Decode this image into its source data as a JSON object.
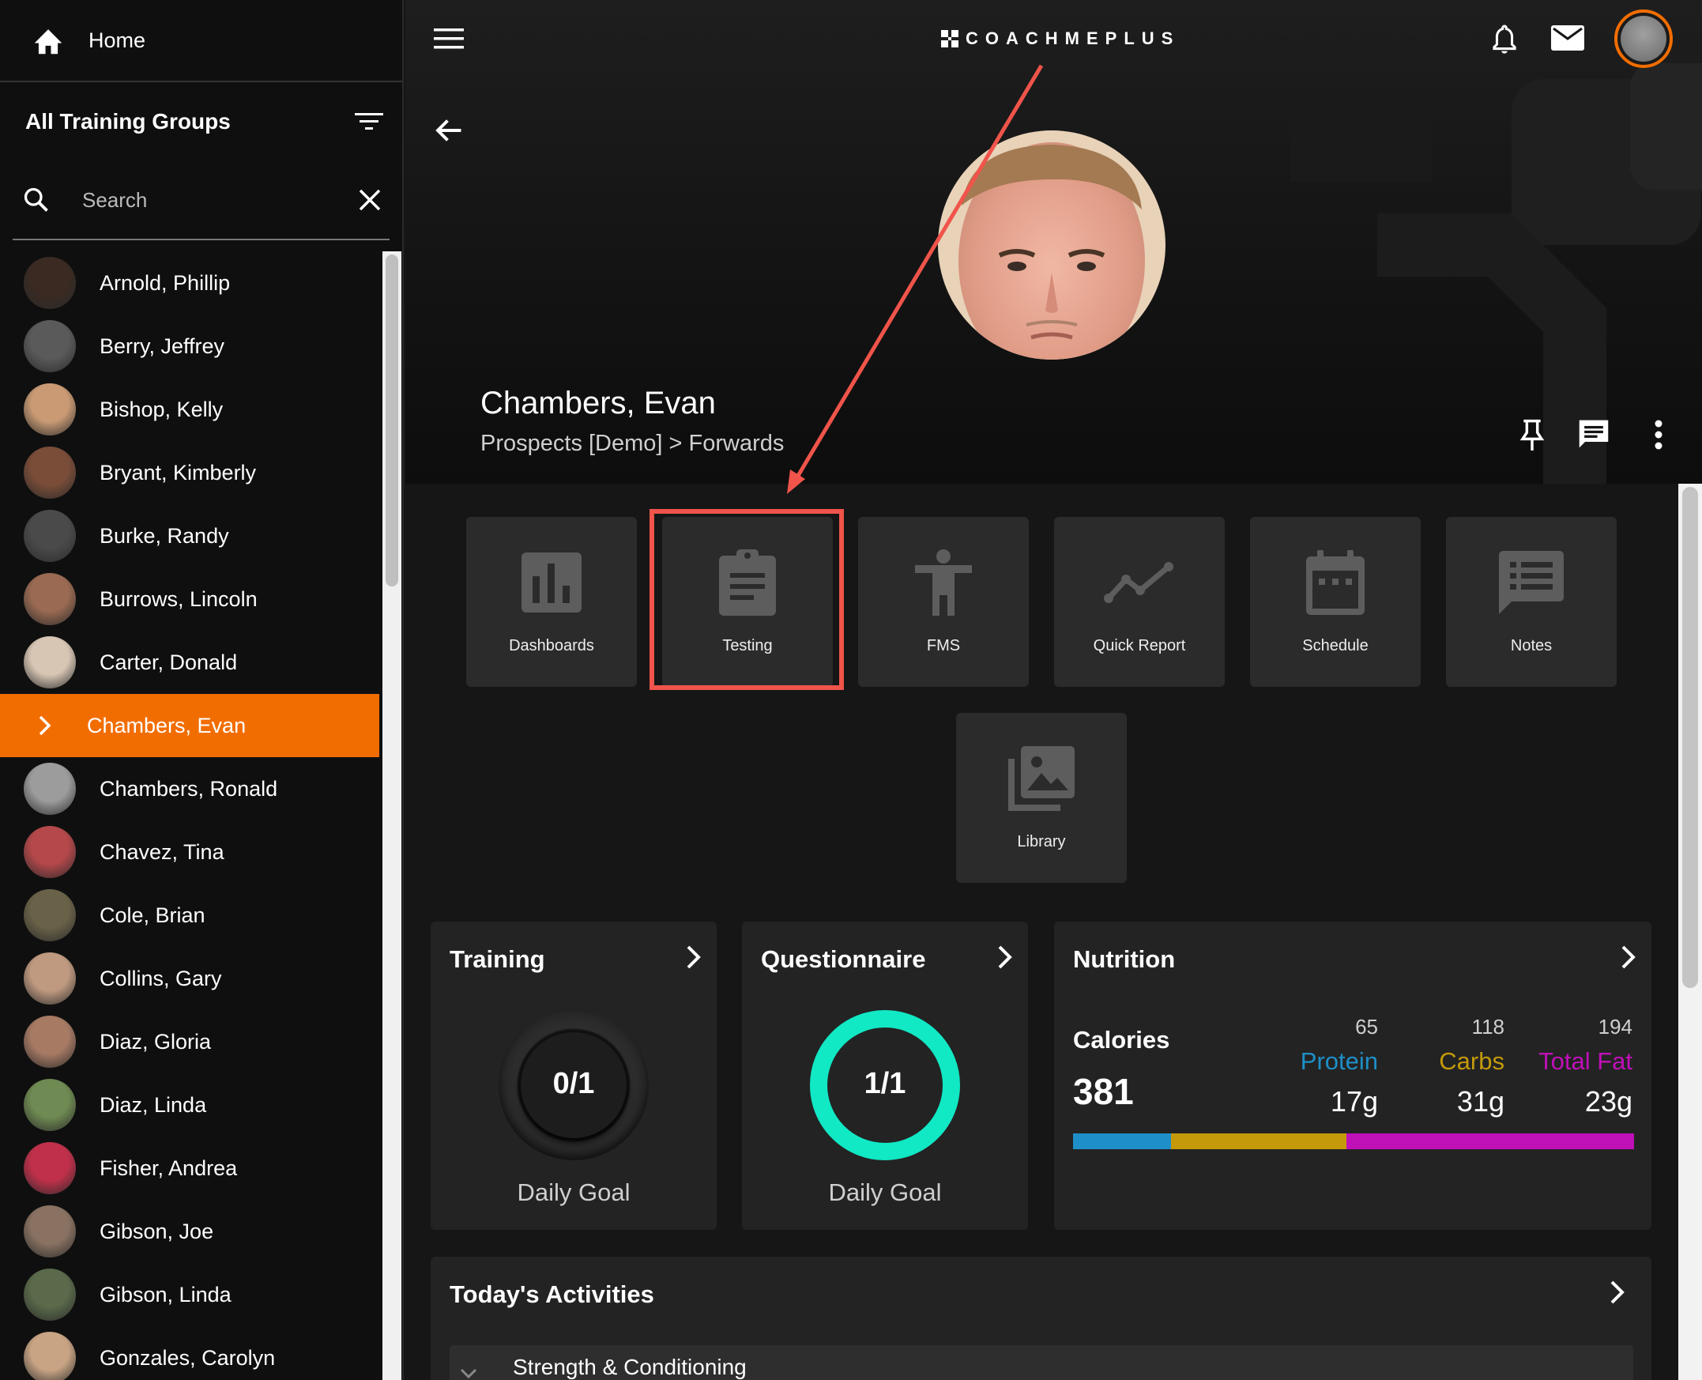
{
  "sidebar": {
    "home_label": "Home",
    "groups_title": "All Training Groups",
    "search_placeholder": "Search",
    "athletes": [
      {
        "name": "Arnold, Phillip",
        "avatar_color": "#3a2a22"
      },
      {
        "name": "Berry, Jeffrey",
        "avatar_color": "#5a5a5a"
      },
      {
        "name": "Bishop, Kelly",
        "avatar_color": "#c99a74"
      },
      {
        "name": "Bryant, Kimberly",
        "avatar_color": "#7a4d38"
      },
      {
        "name": "Burke, Randy",
        "avatar_color": "#4a4a4a"
      },
      {
        "name": "Burrows, Lincoln",
        "avatar_color": "#9a6a52"
      },
      {
        "name": "Carter, Donald",
        "avatar_color": "#d8c6b4"
      },
      {
        "name": "Chambers, Evan",
        "avatar_color": "#d99a82",
        "active": true
      },
      {
        "name": "Chambers, Ronald",
        "avatar_color": "#9c9c9c"
      },
      {
        "name": "Chavez, Tina",
        "avatar_color": "#b4484a"
      },
      {
        "name": "Cole, Brian",
        "avatar_color": "#6a6248"
      },
      {
        "name": "Collins, Gary",
        "avatar_color": "#c09a80"
      },
      {
        "name": "Diaz, Gloria",
        "avatar_color": "#a77a64"
      },
      {
        "name": "Diaz, Linda",
        "avatar_color": "#6f8a52"
      },
      {
        "name": "Fisher, Andrea",
        "avatar_color": "#c0304a"
      },
      {
        "name": "Gibson, Joe",
        "avatar_color": "#8a7262"
      },
      {
        "name": "Gibson, Linda",
        "avatar_color": "#5a6a4a"
      },
      {
        "name": "Gonzales, Carolyn",
        "avatar_color": "#c8a484"
      }
    ]
  },
  "header": {
    "logo_text": "COACHMEPLUS"
  },
  "profile": {
    "name": "Chambers, Evan",
    "group_path": "Prospects [Demo] > Forwards"
  },
  "tiles": [
    {
      "label": "Dashboards",
      "icon": "bar-chart-icon"
    },
    {
      "label": "Testing",
      "icon": "clipboard-icon"
    },
    {
      "label": "FMS",
      "icon": "person-icon"
    },
    {
      "label": "Quick Report",
      "icon": "trend-line-icon"
    },
    {
      "label": "Schedule",
      "icon": "calendar-icon"
    },
    {
      "label": "Notes",
      "icon": "notes-icon"
    },
    {
      "label": "Library",
      "icon": "photo-library-icon"
    }
  ],
  "training": {
    "title": "Training",
    "progress": "0/1",
    "goal_label": "Daily Goal",
    "completion": 0
  },
  "questionnaire": {
    "title": "Questionnaire",
    "progress": "1/1",
    "goal_label": "Daily Goal",
    "completion": 1
  },
  "nutrition": {
    "title": "Nutrition",
    "calories_label": "Calories",
    "calories_value": "381",
    "macros": [
      {
        "target": "65",
        "label": "Protein",
        "value": "17g",
        "color": "#1e8fc8",
        "share": 0.174
      },
      {
        "target": "118",
        "label": "Carbs",
        "value": "31g",
        "color": "#c49a0a",
        "share": 0.313
      },
      {
        "target": "194",
        "label": "Total Fat",
        "value": "23g",
        "color": "#c010b8",
        "share": 0.513
      }
    ]
  },
  "activities": {
    "title": "Today's Activities",
    "first_item": "Strength & Conditioning"
  },
  "colors": {
    "accent": "#f26d00",
    "annotation": "#f0544a",
    "ring_complete": "#11e8c4"
  }
}
